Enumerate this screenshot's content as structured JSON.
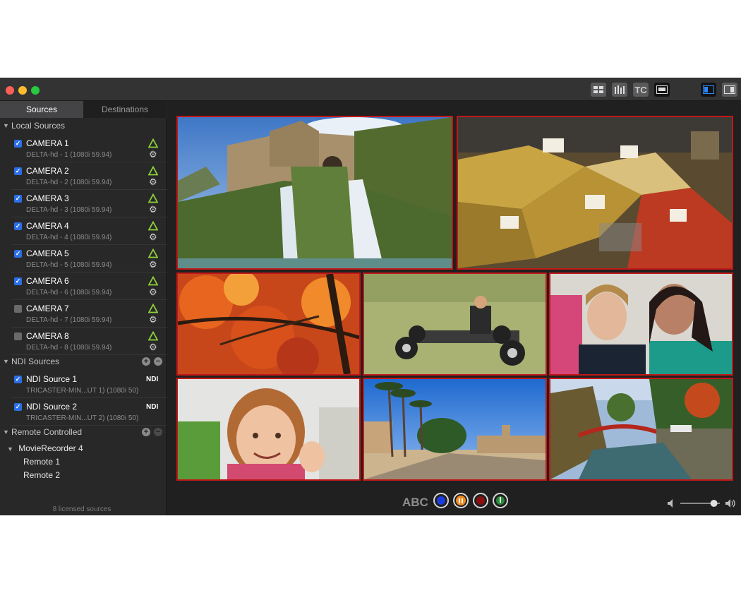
{
  "titlebar": {
    "tc_label": "TC"
  },
  "sidebar": {
    "tabs": {
      "sources": "Sources",
      "destinations": "Destinations"
    },
    "local_sources": {
      "label": "Local Sources",
      "cameras": [
        {
          "name": "CAMERA 1",
          "sub": "DELTA-hd - 1 (1080i 59.94)",
          "checked": true
        },
        {
          "name": "CAMERA 2",
          "sub": "DELTA-hd - 2 (1080i 59.94)",
          "checked": true
        },
        {
          "name": "CAMERA 3",
          "sub": "DELTA-hd - 3 (1080i 59.94)",
          "checked": true
        },
        {
          "name": "CAMERA 4",
          "sub": "DELTA-hd - 4 (1080i 59.94)",
          "checked": true
        },
        {
          "name": "CAMERA 5",
          "sub": "DELTA-hd - 5 (1080i 59.94)",
          "checked": true
        },
        {
          "name": "CAMERA 6",
          "sub": "DELTA-hd - 6 (1080i 59.94)",
          "checked": true
        },
        {
          "name": "CAMERA 7",
          "sub": "DELTA-hd - 7 (1080i 59.94)",
          "checked": false
        },
        {
          "name": "CAMERA 8",
          "sub": "DELTA-hd - 8 (1080i 59.94)",
          "checked": false
        }
      ]
    },
    "ndi_sources": {
      "label": "NDI Sources",
      "tag": "NDI",
      "items": [
        {
          "name": "NDI Source 1",
          "sub": "TRICASTER-MIN...UT 1) (1080i 50)",
          "checked": true
        },
        {
          "name": "NDI Source 2",
          "sub": "TRICASTER-MIN...UT 2) (1080i 50)",
          "checked": true
        }
      ]
    },
    "remote_controlled": {
      "label": "Remote Controlled",
      "recorder": "MovieRecorder 4",
      "remotes": [
        "Remote 1",
        "Remote 2"
      ]
    },
    "licensed": "8 licensed sources"
  },
  "bottombar": {
    "abc_label": "ABC",
    "volume_level": 0.85
  },
  "colors": {
    "accent_blue": "#2b6fe6",
    "tile_border": "#c01818",
    "warning_green": "#8ed13a",
    "record_orange": "#f0891c"
  }
}
